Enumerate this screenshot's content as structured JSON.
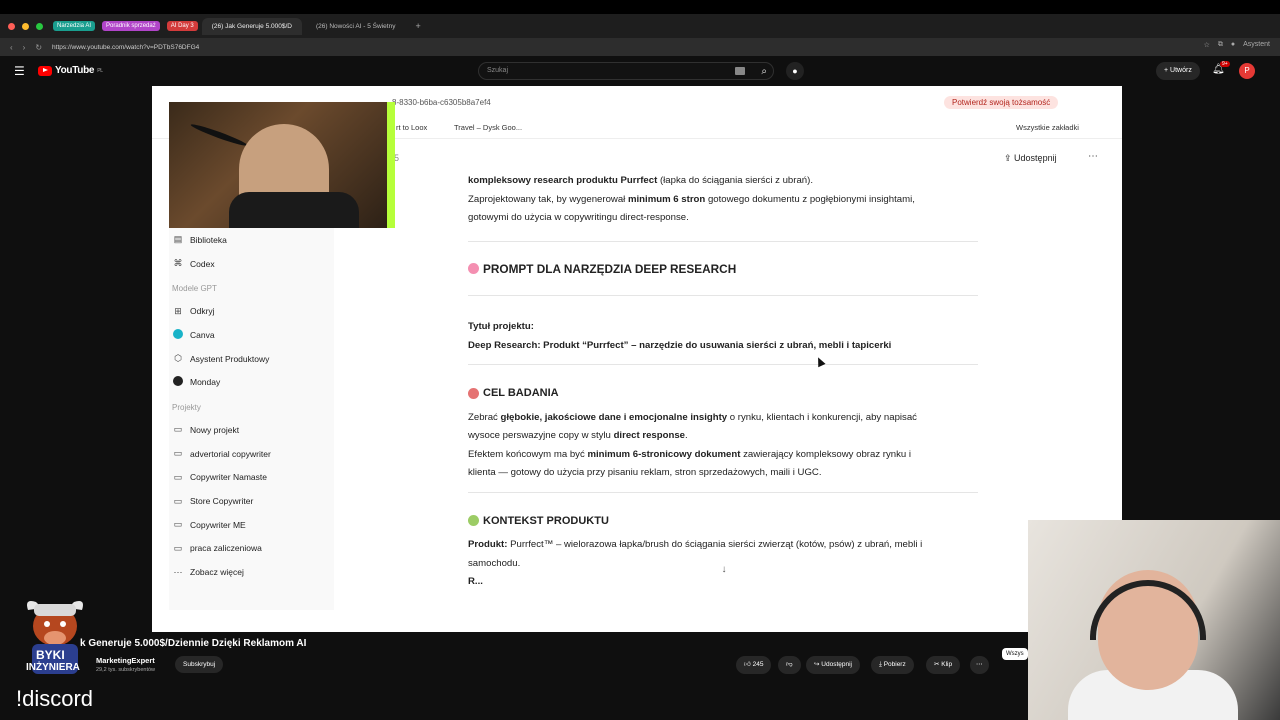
{
  "browser": {
    "tab_groups": [
      {
        "label": "Narzedzia AI",
        "color": "#1a9e8f"
      },
      {
        "label": "Poradnik sprzedaż",
        "color": "#b145c9"
      },
      {
        "label": "AI Day 3",
        "color": "#d33b3b"
      }
    ],
    "tabs": [
      {
        "label": "(26) Jak Generuje 5.000$/D",
        "active": true
      },
      {
        "label": "(26) Nowości AI - 5 Świetny",
        "active": false
      }
    ],
    "url": "https://www.youtube.com/watch?v=PDTbS76DFG4",
    "assistant_label": "Asystent"
  },
  "youtube": {
    "logo_text": "YouTube",
    "logo_sup": "PL",
    "search_placeholder": "Szukaj",
    "create_label": "Utwórz",
    "notif_badge": "9+",
    "avatar_letter": "P"
  },
  "inner_browser": {
    "url_fragment": "8-8330-b6ba-c6305b8a7ef4",
    "verify_label": "Potwierdź swoją tożsamość",
    "bookmarks": [
      "rt to Loox",
      "Travel – Dysk Goo..."
    ],
    "all_bookmarks": "Wszystkie zakładki",
    "share_label": "Udostępnij",
    "version_fragment": "5"
  },
  "sidebar": {
    "top_items": [
      {
        "icon": "library-icon",
        "label": "Biblioteka"
      },
      {
        "icon": "codex-icon",
        "label": "Codex"
      }
    ],
    "gpt_section": "Modele GPT",
    "gpt_items": [
      {
        "icon": "explore-icon",
        "label": "Odkryj"
      },
      {
        "icon": "canva-icon",
        "label": "Canva"
      },
      {
        "icon": "cube-icon",
        "label": "Asystent Produktowy"
      },
      {
        "icon": "monday-icon",
        "label": "Monday"
      }
    ],
    "projects_section": "Projekty",
    "project_items": [
      {
        "icon": "folder-icon",
        "label": "Nowy projekt"
      },
      {
        "icon": "folder-icon",
        "label": "advertorial copywriter"
      },
      {
        "icon": "folder-icon",
        "label": "Copywriter Namaste"
      },
      {
        "icon": "folder-icon",
        "label": "Store Copywriter"
      },
      {
        "icon": "folder-icon",
        "label": "Copywriter ME"
      },
      {
        "icon": "folder-icon",
        "label": "praca zaliczeniowa"
      },
      {
        "icon": "more-icon",
        "label": "Zobacz więcej"
      }
    ]
  },
  "document": {
    "intro_p1_b": "kompleksowy research produktu Purrfect",
    "intro_p1_rest": " (łapka do ściągania sierści z ubrań).",
    "intro_p2_a": "Zaprojektowany tak, by wygenerował ",
    "intro_p2_b": "minimum 6 stron",
    "intro_p2_c": " gotowego dokumentu z pogłębionymi insightami,",
    "intro_p3": "gotowymi do użycia w copywritingu direct-response.",
    "heading1": "PROMPT DLA NARZĘDZIA DEEP RESEARCH",
    "title_label": "Tytuł projektu:",
    "title_value": "Deep Research: Produkt “Purrfect” – narzędzie do usuwania sierści z ubrań, mebli i tapicerki",
    "heading2": "CEL BADANIA",
    "goal_a": "Zebrać ",
    "goal_b": "głębokie, jakościowe dane i emocjonalne insighty",
    "goal_c": " o rynku, klientach i konkurencji, aby napisać",
    "goal_d": "wysoce perswazyjne copy w stylu ",
    "goal_e": "direct response",
    "goal_f": ".",
    "effect_a": "Efektem końcowym ma być ",
    "effect_b": "minimum 6-stronicowy dokument",
    "effect_c": " zawierający kompleksowy obraz rynku i",
    "effect_d": "klienta — gotowy do użycia przy pisaniu reklam, stron sprzedażowych, maili i UGC.",
    "heading3": "KONTEKST PRODUKTU",
    "product_label": "Produkt:",
    "product_text": " Purrfect™ – wielorazowa łapka/brush do ściągania sierści zwierząt (kotów, psów) z ubrań, mebli i",
    "product_text2": "samochodu.",
    "cut_line": "R..."
  },
  "player": {
    "video_title": "k Generuje 5.000$/Dziennie Dzięki Reklamom AI",
    "channel_name": "MarketingExpert",
    "subscribers": "29,2 tys. subskrybentów",
    "subscribe_label": "Subskrybuj",
    "likes": "245",
    "share_label": "Udostępnij",
    "download_label": "Pobierz",
    "clip_label": "Klip",
    "side_label": "Wszys"
  },
  "overlay": {
    "badge_line1": "BYKI",
    "badge_line2": "INŻYNIERA",
    "discord_text": "!discord"
  }
}
